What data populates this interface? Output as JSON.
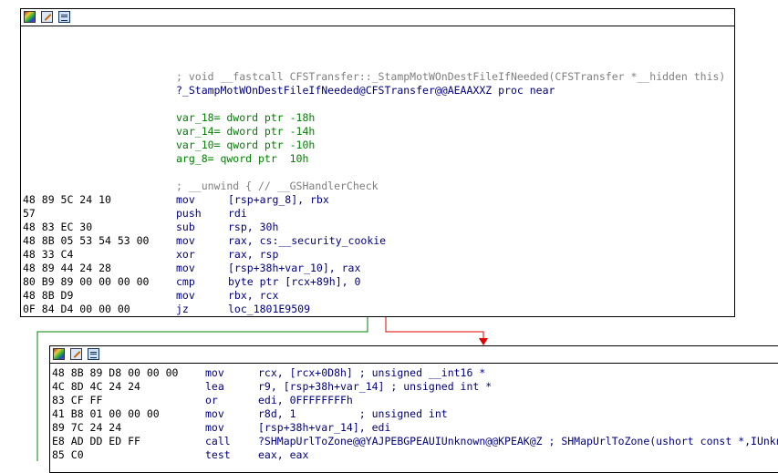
{
  "node1": {
    "header_lines": [
      {
        "name": "func-signature-comment",
        "text": "; void __fastcall CFSTransfer::_StampMotWOnDestFileIfNeeded(CFSTransfer *__hidden this)"
      },
      {
        "name": "proc-declaration",
        "text": "?_StampMotWOnDestFileIfNeeded@CFSTransfer@@AEAAXXZ proc near"
      },
      {
        "name": "var-18-decl",
        "text": "var_18= dword ptr -18h"
      },
      {
        "name": "var-14-decl",
        "text": "var_14= dword ptr -14h"
      },
      {
        "name": "var-10-decl",
        "text": "var_10= qword ptr -10h"
      },
      {
        "name": "arg-8-decl",
        "text": "arg_8= qword ptr  10h"
      },
      {
        "name": "unwind-comment",
        "text": "; __unwind { // __GSHandlerCheck"
      }
    ],
    "instructions": [
      {
        "bytes": "48 89 5C 24 10",
        "mnem": "mov",
        "ops": "[rsp+arg_8], rbx"
      },
      {
        "bytes": "57",
        "mnem": "push",
        "ops": "rdi"
      },
      {
        "bytes": "48 83 EC 30",
        "mnem": "sub",
        "ops": "rsp, 30h"
      },
      {
        "bytes": "48 8B 05 53 54 53 00",
        "mnem": "mov",
        "ops": "rax, cs:__security_cookie"
      },
      {
        "bytes": "48 33 C4",
        "mnem": "xor",
        "ops": "rax, rsp"
      },
      {
        "bytes": "48 89 44 24 28",
        "mnem": "mov",
        "ops": "[rsp+38h+var_10], rax"
      },
      {
        "bytes": "80 B9 89 00 00 00 00",
        "mnem": "cmp",
        "ops": "byte ptr [rcx+89h], 0"
      },
      {
        "bytes": "48 8B D9",
        "mnem": "mov",
        "ops": "rbx, rcx"
      },
      {
        "bytes": "0F 84 D4 00 00 00",
        "mnem": "jz",
        "ops": "loc_1801E9509"
      }
    ]
  },
  "node2": {
    "instructions": [
      {
        "bytes": "48 8B 89 D8 00 00 00",
        "mnem": "mov",
        "ops": "rcx, [rcx+0D8h] ; unsigned __int16 *"
      },
      {
        "bytes": "4C 8D 4C 24 24",
        "mnem": "lea",
        "ops": "r9, [rsp+38h+var_14] ; unsigned int *"
      },
      {
        "bytes": "83 CF FF",
        "mnem": "or",
        "ops": "edi, 0FFFFFFFFh"
      },
      {
        "bytes": "41 B8 01 00 00 00",
        "mnem": "mov",
        "ops": "r8d, 1          ; unsigned int"
      },
      {
        "bytes": "89 7C 24 24",
        "mnem": "mov",
        "ops": "[rsp+38h+var_14], edi"
      },
      {
        "bytes": "E8 AD DD ED FF",
        "mnem": "call",
        "ops": "?SHMapUrlToZone@@YAJPEBGPEAUIUnknown@@KPEAK@Z ; SHMapUrlToZone(ushort const *,IUnknown *,ulong,ulong *)"
      },
      {
        "bytes": "85 C0",
        "mnem": "test",
        "ops": "eax, eax"
      }
    ]
  },
  "icons": [
    "graph-icon",
    "edit-icon",
    "listing-icon"
  ],
  "colors": {
    "edge_true": "#008000",
    "edge_false": "#e00000",
    "text_blue": "#00007f",
    "comment_gray": "#7f7f7f"
  }
}
